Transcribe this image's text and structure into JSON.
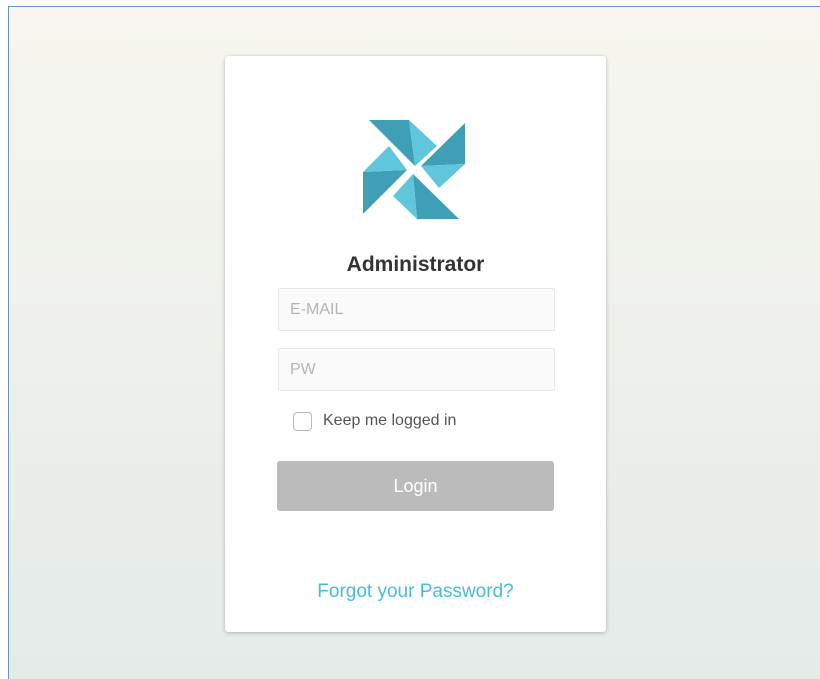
{
  "login": {
    "title": "Administrator",
    "email": {
      "value": "",
      "placeholder": "E-MAIL"
    },
    "password": {
      "value": "",
      "placeholder": "PW"
    },
    "remember_label": "Keep me logged in",
    "remember_checked": false,
    "login_label": "Login",
    "forgot_label": "Forgot your Password?"
  },
  "colors": {
    "logo_dark": "#3f9fb5",
    "logo_light": "#5fc6dc",
    "link": "#45bde0",
    "button_disabled": "#bbbbbb",
    "title": "#333333"
  },
  "icons": {
    "logo": "pinwheel-logo-icon",
    "checkbox": "checkbox-unchecked-icon"
  }
}
